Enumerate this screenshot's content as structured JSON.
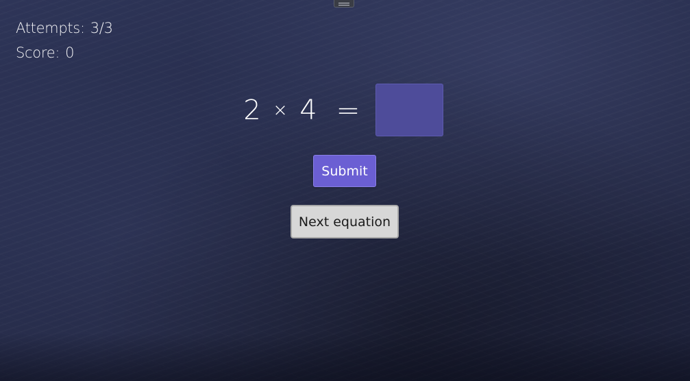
{
  "stats": {
    "attempts_label": "Attempts:",
    "attempts_value": "3/3",
    "score_label": "Score:",
    "score_value": "0"
  },
  "equation": {
    "left_operand": "2",
    "operator": "×",
    "right_operand": "4",
    "equals": "=",
    "answer_value": ""
  },
  "actions": {
    "submit_label": "Submit",
    "next_label": "Next equation"
  },
  "colors": {
    "board_background": "#262c4b",
    "answer_box": "#4e4c9a",
    "submit_button": "#6b5fd3",
    "next_button": "#d7d7d7"
  }
}
